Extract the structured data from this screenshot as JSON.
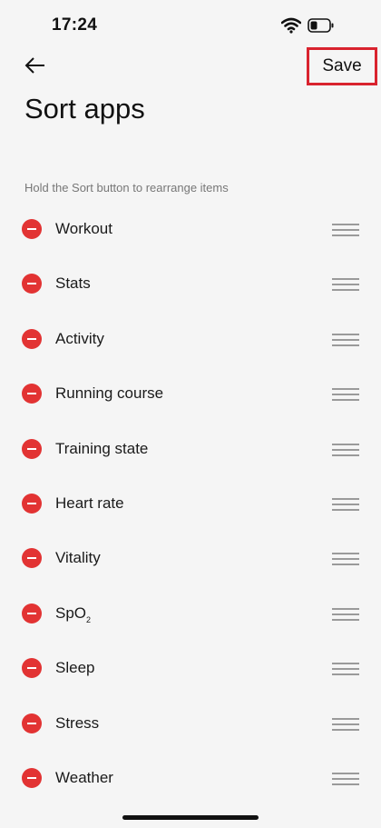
{
  "status_bar": {
    "time": "17:24"
  },
  "header": {
    "save_label": "Save",
    "title": "Sort apps"
  },
  "hint": "Hold the Sort button to rearrange items",
  "items": [
    {
      "label": "Workout"
    },
    {
      "label": "Stats"
    },
    {
      "label": "Activity"
    },
    {
      "label": "Running course"
    },
    {
      "label": "Training state"
    },
    {
      "label": "Heart rate"
    },
    {
      "label": "Vitality"
    },
    {
      "label": "SpO",
      "subscript": "2"
    },
    {
      "label": "Sleep"
    },
    {
      "label": "Stress"
    },
    {
      "label": "Weather"
    }
  ],
  "colors": {
    "accent": "#e23333",
    "highlight_border": "#d9232e",
    "background": "#f5f5f5"
  },
  "icons": {
    "back": "arrow-left-icon",
    "remove": "minus-circle-icon",
    "drag": "drag-handle-icon",
    "wifi": "wifi-icon",
    "battery": "battery-icon"
  }
}
